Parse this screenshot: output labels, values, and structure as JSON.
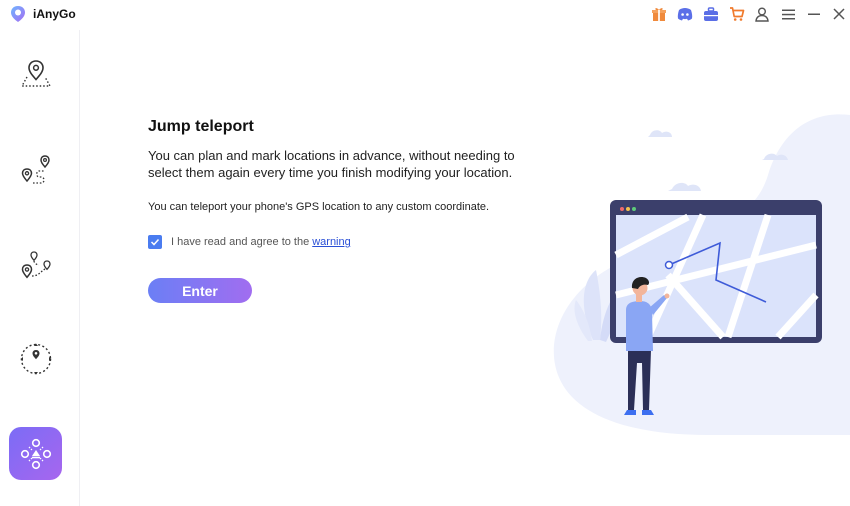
{
  "app": {
    "title": "iAnyGo"
  },
  "titlebar": {
    "icons": [
      "gift-icon",
      "discord-icon",
      "toolbox-icon",
      "cart-icon",
      "user-icon",
      "menu-icon",
      "minimize-icon",
      "close-icon"
    ]
  },
  "sidebar": {
    "items": [
      {
        "name": "change-location",
        "icon": "map-pin-icon",
        "active": false
      },
      {
        "name": "single-spot-movement",
        "icon": "route-icon",
        "active": false
      },
      {
        "name": "multi-spot-movement",
        "icon": "multi-route-icon",
        "active": false
      },
      {
        "name": "joystick-movement",
        "icon": "joystick-icon",
        "active": false
      },
      {
        "name": "jump-teleport",
        "icon": "teleport-icon",
        "active": true
      }
    ]
  },
  "main": {
    "heading": "Jump teleport",
    "description": "You can plan and mark locations in advance, without needing to select them again every time you finish modifying your location.",
    "note": "You can teleport your phone's GPS location to any custom coordinate.",
    "agree_text": "I have read and agree to the",
    "warning_link": "warning",
    "agree_checked": true,
    "enter_label": "Enter"
  },
  "colors": {
    "accent_start": "#6b7ff5",
    "accent_end": "#a16df0",
    "checkbox": "#4a7cf0",
    "link": "#2a4fd6",
    "illustration_bg": "#eef1fc",
    "screen_frame": "#3b3f6b"
  }
}
